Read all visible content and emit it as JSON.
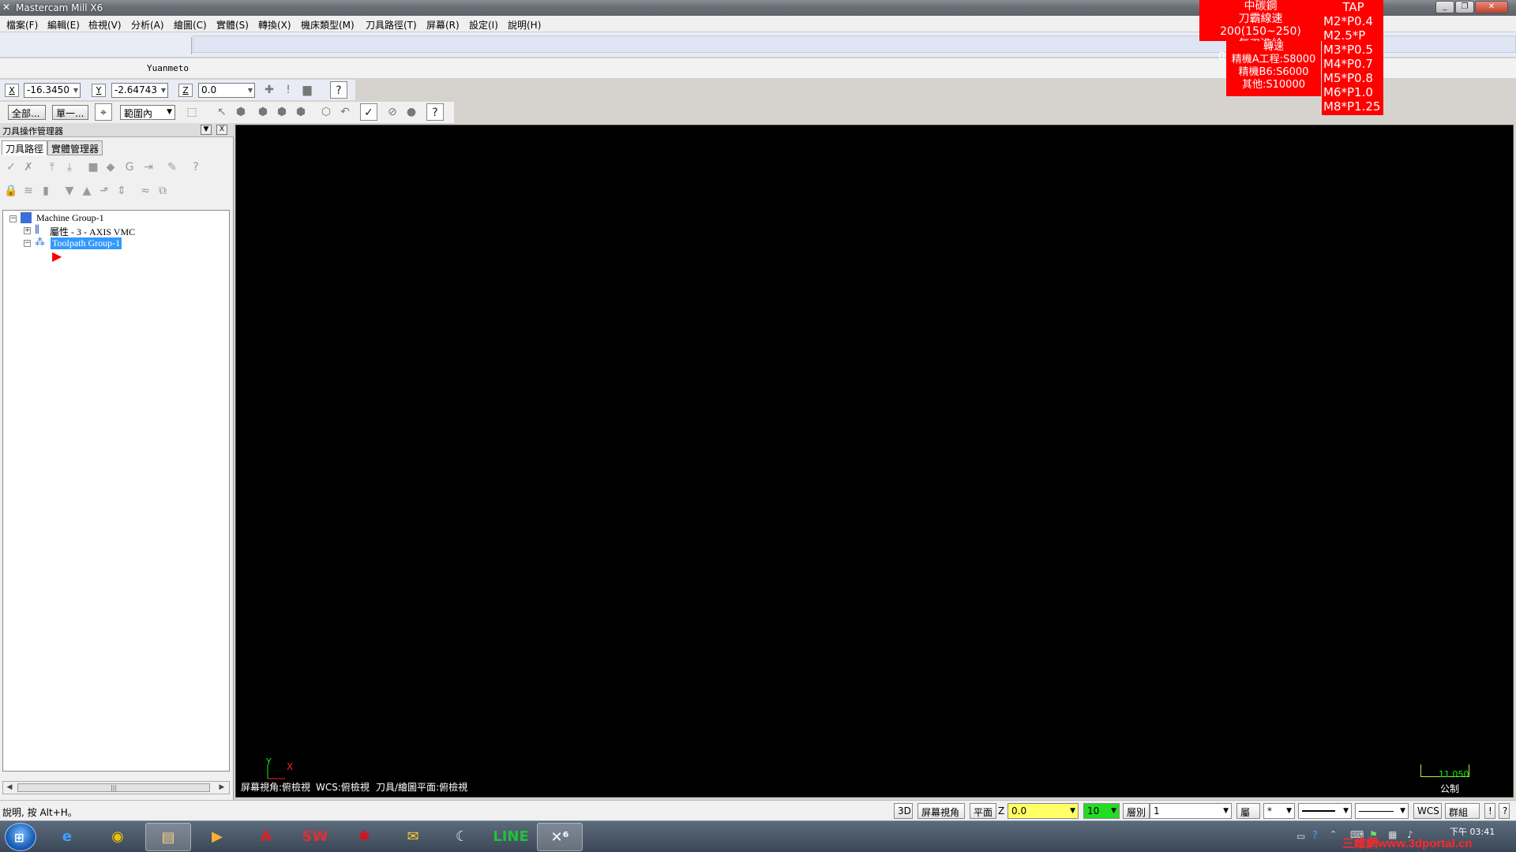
{
  "window": {
    "title": "Mastercam Mill X6"
  },
  "menu": [
    "檔案(F)",
    "編輯(E)",
    "檢視(V)",
    "分析(A)",
    "繪圖(C)",
    "實體(S)",
    "轉換(X)",
    "機床類型(M)",
    "刀具路徑(T)",
    "屏幕(R)",
    "設定(I)",
    "說明(H)"
  ],
  "toolbar": {
    "username": "Yuanmeto"
  },
  "coords": {
    "x_label": "X",
    "x_value": "-16.3450",
    "y_label": "Y",
    "y_value": "-2.64743",
    "z_label": "Z",
    "z_value": "0.0"
  },
  "selection": {
    "all_label": "全部...",
    "single_label": "單一...",
    "range_label": "範圍內"
  },
  "panel": {
    "title": "刀具操作管理器",
    "tabs": [
      "刀具路徑",
      "實體管理器"
    ],
    "tree": {
      "machine_group": "Machine Group-1",
      "properties": "屬性 - 3 - AXIS VMC",
      "toolpath_group": "Toolpath Group-1"
    }
  },
  "viewport": {
    "bottom_text": [
      "屏幕視角:俯檢視",
      "WCS:俯檢視",
      "刀具/繪圖平面:俯檢視"
    ],
    "axis_y": "Y",
    "axis_x": "X",
    "scale_value": "11.050",
    "scale_unit": "公制"
  },
  "overlay_notes": {
    "box1": [
      "中碳鋼",
      "刀霸線速200(150~250)",
      "每刃進給0.1(0.08~0.15)"
    ],
    "box2": [
      "轉速",
      "精機A工程:S8000",
      "精機B6:S6000",
      "其他:S10000"
    ],
    "box3": [
      "TAP",
      "M2*P0.4",
      "M2.5*P",
      "M3*P0.5",
      "M4*P0.7",
      "M5*P0.8",
      "M6*P1.0",
      "M8*P1.25"
    ]
  },
  "status": {
    "help_text": "說明, 按 Alt+H。",
    "btn_3d": "3D",
    "btn_screen_view": "屏幕視角",
    "btn_plane": "平面",
    "z_label": "Z",
    "z_value": "0.0",
    "color_value": "10",
    "level_label": "層別",
    "level_value": "1",
    "attributes_label": "屬性",
    "point_style": "*",
    "wcs_label": "WCS",
    "group_label": "群組組"
  },
  "taskbar": {
    "clock_ampm": "下午 03:41",
    "clock_date": "",
    "watermark": "三維網www.3dportal.cn"
  },
  "colors": {
    "overlay_red": "#ff0000",
    "z_field_yellow": "#ffff66",
    "color_field_green": "#22dd22",
    "selection_blue": "#3399ff"
  }
}
